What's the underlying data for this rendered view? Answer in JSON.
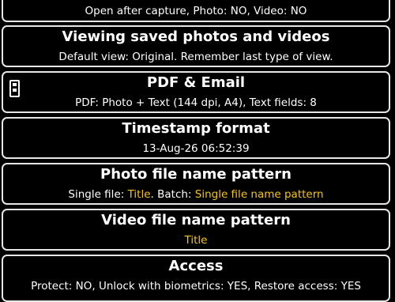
{
  "capture": {
    "subtitle": "Open after capture, Photo: NO, Video: NO"
  },
  "viewing": {
    "title": "Viewing saved photos and videos",
    "subtitle": "Default view: Original. Remember last type of view."
  },
  "pdf": {
    "icon": "document-icon",
    "title": "PDF & Email",
    "subtitle": "PDF: Photo + Text (144 dpi, A4), Text fields: 8"
  },
  "timestamp": {
    "title": "Timestamp format",
    "subtitle": "13-Aug-26 06:52:39"
  },
  "photo_name": {
    "title": "Photo file name pattern",
    "single_prefix": "Single file: ",
    "single_value": "Title",
    "batch_prefix": ". Batch: ",
    "batch_value": "Single file name pattern"
  },
  "video_name": {
    "title": "Video file name pattern",
    "value": "Title"
  },
  "access": {
    "title": "Access",
    "subtitle": "Protect: NO, Unlock with biometrics: YES, Restore access: YES"
  },
  "colors": {
    "background": "#000000",
    "border": "#e6e6e6",
    "highlight": "#f5c518"
  }
}
